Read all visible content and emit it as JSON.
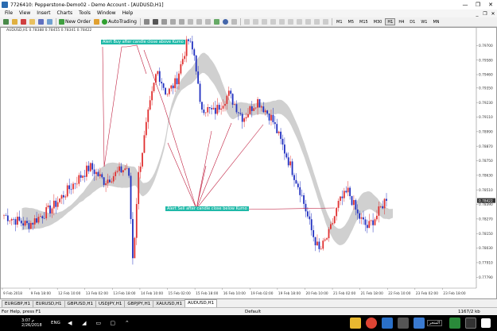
{
  "window": {
    "title": "7726410: Pepperstone-Demo02 - Demo Account - [AUDUSD,H1]",
    "minimize": "—",
    "maximize": "❐",
    "close": "✕"
  },
  "menu": {
    "items": [
      "File",
      "View",
      "Insert",
      "Charts",
      "Tools",
      "Window",
      "Help"
    ],
    "mdi_minimize": "_",
    "mdi_restore": "❐",
    "mdi_close": "✕"
  },
  "toolbar": {
    "new_order": "New Order",
    "auto_trading": "AutoTrading",
    "timeframes": [
      "M1",
      "M5",
      "M15",
      "M30",
      "H1",
      "H4",
      "D1",
      "W1",
      "MN"
    ]
  },
  "chart": {
    "symbol_info": "AUDUSD,H1  0.78388 0.78455 0.78341 0.78422",
    "annotation_buy": "Alert Buy after candle close above Kumo",
    "annotation_sell": "Alert Sell after candle close below Kumo",
    "price_labels": [
      "0.79700",
      "0.79580",
      "0.79460",
      "0.79350",
      "0.79230",
      "0.79110",
      "0.78990",
      "0.78870",
      "0.78750",
      "0.78630",
      "0.78510",
      "0.78390",
      "0.78270",
      "0.78150",
      "0.78030",
      "0.77910",
      "0.77790"
    ],
    "current_price": "0.78422",
    "time_labels": [
      "9 Feb 2018",
      "9 Feb 18:00",
      "12 Feb 10:00",
      "13 Feb 02:00",
      "13 Feb 18:00",
      "14 Feb 10:00",
      "15 Feb 02:00",
      "15 Feb 18:00",
      "16 Feb 10:00",
      "19 Feb 02:00",
      "19 Feb 18:00",
      "20 Feb 10:00",
      "21 Feb 02:00",
      "21 Feb 18:00",
      "22 Feb 10:00",
      "23 Feb 02:00",
      "23 Feb 18:00"
    ],
    "colors": {
      "bull": "#e03030",
      "bear": "#2030c0",
      "cloud": "#c8c8c8",
      "trendline": "#c02040",
      "annotation_bg": "#1fb9a8"
    }
  },
  "tabs": [
    "EURGBP,H1",
    "EURUSD,H1",
    "GBPUSD,H1",
    "USDJPY,H1",
    "GBPJPY,H1",
    "XAUUSD,H1",
    "AUDUSD,H1"
  ],
  "active_tab": "AUDUSD,H1",
  "status": {
    "help": "For Help, press F1",
    "profile": "Default",
    "traffic": "1167/2 kb"
  },
  "taskbar": {
    "clock_time": "3:07 م",
    "clock_date": "2/26/2018",
    "lang": "ENG",
    "app_label": "المتجر"
  }
}
